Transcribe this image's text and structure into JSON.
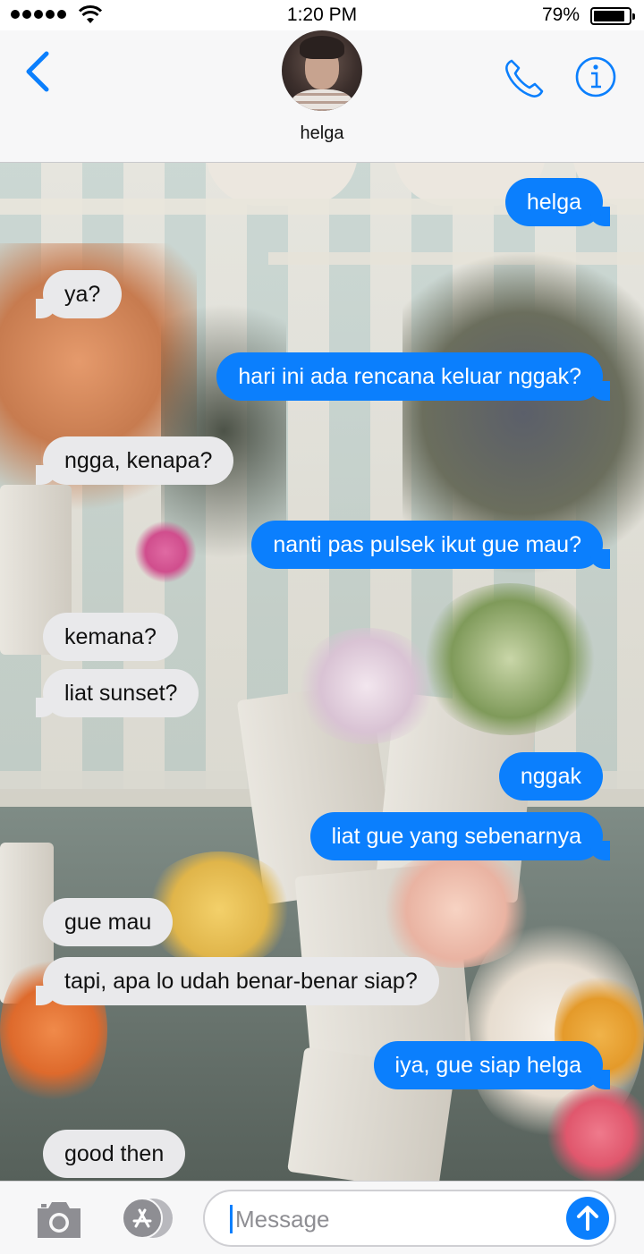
{
  "status_bar": {
    "time": "1:20 PM",
    "battery": "79%"
  },
  "header": {
    "contact_name": "helga"
  },
  "messages": [
    {
      "dir": "out",
      "text": "helga"
    },
    {
      "dir": "in",
      "text": "ya?"
    },
    {
      "dir": "out",
      "text": "hari ini ada rencana keluar nggak?"
    },
    {
      "dir": "in",
      "text": "ngga, kenapa?"
    },
    {
      "dir": "out",
      "text": "nanti pas pulsek ikut gue mau?"
    },
    {
      "dir": "in",
      "text": "kemana?"
    },
    {
      "dir": "in",
      "text": "liat sunset?"
    },
    {
      "dir": "out",
      "text": "nggak"
    },
    {
      "dir": "out",
      "text": "liat gue yang sebenarnya"
    },
    {
      "dir": "in",
      "text": "gue mau"
    },
    {
      "dir": "in",
      "text": "tapi, apa lo udah benar-benar siap?"
    },
    {
      "dir": "out",
      "text": "iya, gue siap helga"
    },
    {
      "dir": "in",
      "text": "good then"
    }
  ],
  "input": {
    "placeholder": "Message"
  },
  "colors": {
    "accent": "#0b7ffd",
    "incoming_bubble": "#e9e9eb"
  }
}
